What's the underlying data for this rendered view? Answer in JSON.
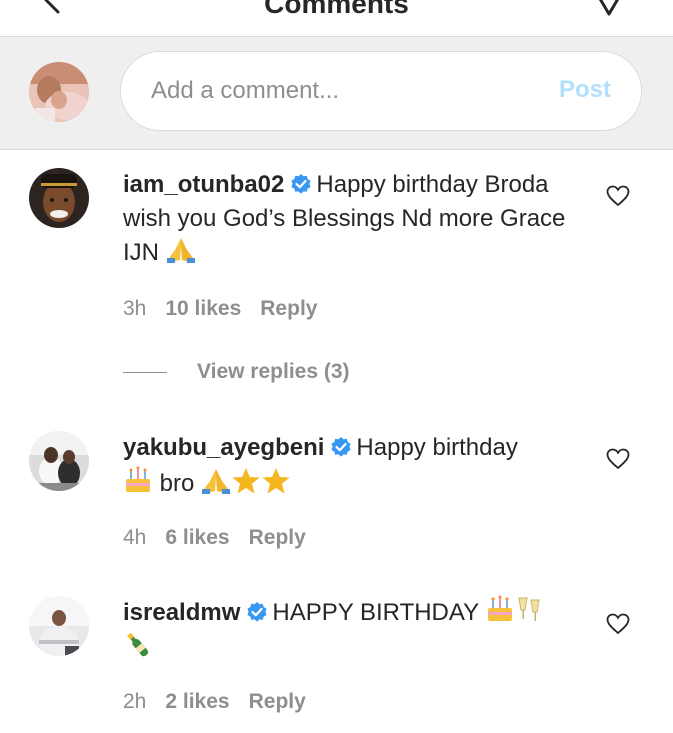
{
  "header": {
    "title": "Comments"
  },
  "composer": {
    "placeholder": "Add a comment...",
    "post_label": "Post"
  },
  "comments": [
    {
      "username": "iam_otunba02",
      "text": "Happy birthday Broda wish you God’s Blessings Nd more Grace IJN",
      "time": "3h",
      "likes": "10 likes",
      "reply": "Reply",
      "view_replies": "View replies (3)"
    },
    {
      "username": "yakubu_ayegbeni",
      "text_before": "Happy birthday",
      "text_after": "bro",
      "time": "4h",
      "likes": "6 likes",
      "reply": "Reply"
    },
    {
      "username": "isrealdmw",
      "text": "HAPPY BIRTHDAY",
      "time": "2h",
      "likes": "2 likes",
      "reply": "Reply"
    }
  ],
  "colors": {
    "verified": "#3897f0",
    "post_disabled": "#b2dffc",
    "meta_gray": "#8e8e8e",
    "composer_bg": "#efefef"
  },
  "icons": [
    "back-arrow-icon",
    "send-icon",
    "verified-badge-icon",
    "heart-outline-icon",
    "folded-hands-emoji",
    "star-emoji",
    "birthday-cake-emoji",
    "clinking-glasses-emoji",
    "champagne-bottle-emoji"
  ]
}
